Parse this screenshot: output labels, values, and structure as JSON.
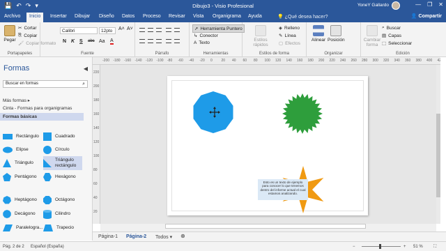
{
  "window": {
    "title": "Dibujo3 - Visio Profesional",
    "user": "YoneY Gallardo",
    "minimize": "—",
    "maximize": "❐",
    "close": "✕"
  },
  "qat": {
    "save": "💾",
    "undo": "↶",
    "redo": "↷",
    "more": "▾"
  },
  "ribbon_tabs": [
    "Archivo",
    "Inicio",
    "Insertar",
    "Dibujar",
    "Diseño",
    "Datos",
    "Proceso",
    "Revisar",
    "Vista",
    "Organigrama",
    "Ayuda"
  ],
  "tell_me": "¿Qué desea hacer?",
  "share": "Compartir",
  "clipboard": {
    "label": "Portapapeles",
    "paste": "Pegar",
    "cut": "Cortar",
    "copy": "Copiar",
    "format_painter": "Copiar formato"
  },
  "font": {
    "label": "Fuente",
    "family": "Calibri",
    "size": "12pto",
    "grow": "A˄",
    "shrink": "A˅",
    "bold": "N",
    "italic": "K",
    "underline": "S",
    "strike": "abc",
    "case": "Aa",
    "color": "A"
  },
  "paragraph": {
    "label": "Párrafo"
  },
  "tools": {
    "label": "Herramientas",
    "pointer": "Herramienta Puntero",
    "connector": "Conector",
    "text": "Texto"
  },
  "shape_styles": {
    "label": "Estilos de forma",
    "quick_styles": "Estilos rápidos",
    "fill": "Relleno",
    "line": "Línea",
    "effects": "Efectos"
  },
  "arrange": {
    "label": "Organizar",
    "align": "Alinear",
    "position": "Posición"
  },
  "edit": {
    "label": "Edición",
    "change_shape": "Cambiar forma",
    "find": "Buscar",
    "layers": "Capas",
    "select": "Seleccionar"
  },
  "shapes_panel": {
    "title": "Formas",
    "search_placeholder": "Buscar en formas",
    "categories": [
      "Más formas",
      "Cinta - Formas para organigramas",
      "Formas básicas"
    ],
    "shapes": [
      "Rectángulo",
      "Cuadrado",
      "Elipse",
      "Círculo",
      "Triángulo",
      "Triángulo rectángulo",
      "Pentágono",
      "Hexágono",
      "Heptágono",
      "Octágono",
      "Decágono",
      "Cilindro",
      "Paralelogra...",
      "Trapecio"
    ]
  },
  "ruler_h": [
    "-200",
    "-180",
    "-160",
    "-140",
    "-120",
    "-100",
    "-80",
    "-60",
    "-40",
    "-20",
    "0",
    "20",
    "40",
    "60",
    "80",
    "100",
    "120",
    "140",
    "160",
    "180",
    "200",
    "220",
    "240",
    "260",
    "280",
    "300",
    "320",
    "340",
    "360",
    "380",
    "400",
    "420"
  ],
  "ruler_v": [
    "220",
    "200",
    "180",
    "160",
    "140",
    "120",
    "100",
    "80",
    "60",
    "40",
    "20"
  ],
  "canvas": {
    "textbox": "Esto es un texto de ejemplo para conocer lo que tenemos dentro del informe actual el cual estamos analizando.",
    "colors": {
      "decagon": "#1e9be8",
      "seal": "#2e9e3c",
      "star": "#f09a12",
      "textbox_bg": "#dbe9f6"
    }
  },
  "page_tabs": [
    "Página-1",
    "Página-2",
    "Todos"
  ],
  "page_tab_add": "⊕",
  "status": {
    "page": "Pág. 2 de 2",
    "language": "Español (España)",
    "zoom": "51 %"
  }
}
